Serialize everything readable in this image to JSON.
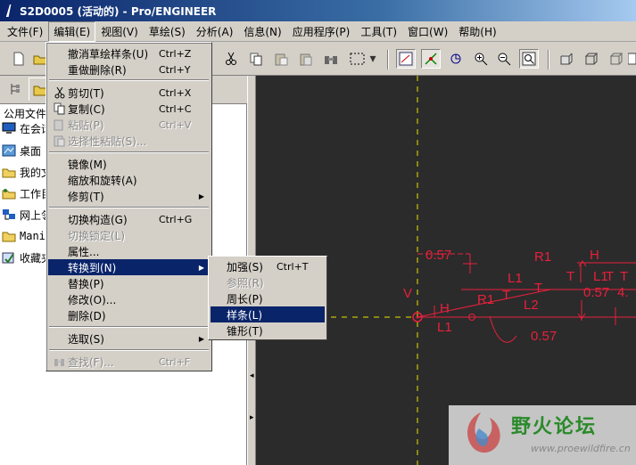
{
  "window": {
    "title": "S2D0005 (活动的) - Pro/ENGINEER"
  },
  "menubar": {
    "items": [
      "文件(F)",
      "编辑(E)",
      "视图(V)",
      "草绘(S)",
      "分析(A)",
      "信息(N)",
      "应用程序(P)",
      "工具(T)",
      "窗口(W)",
      "帮助(H)"
    ],
    "active": "编辑(E)"
  },
  "left_panel": {
    "header": "公用文件",
    "items": [
      "在会话",
      "桌面",
      "我的文",
      "工作目",
      "网上邻",
      "Manik",
      "收藏夹"
    ]
  },
  "edit_menu": {
    "items": [
      {
        "label": "撤消草绘样条(U)",
        "shortcut": "Ctrl+Z",
        "icon": "",
        "enabled": true
      },
      {
        "label": "重做删除(R)",
        "shortcut": "Ctrl+Y",
        "icon": "",
        "enabled": true
      },
      {
        "label": "剪切(T)",
        "shortcut": "Ctrl+X",
        "icon": "scissors-icon",
        "enabled": true
      },
      {
        "label": "复制(C)",
        "shortcut": "Ctrl+C",
        "icon": "copy-icon",
        "enabled": true
      },
      {
        "label": "粘贴(P)",
        "shortcut": "Ctrl+V",
        "icon": "paste-icon",
        "enabled": false
      },
      {
        "label": "选择性粘贴(S)...",
        "shortcut": "",
        "icon": "paste-special-icon",
        "enabled": false
      },
      {
        "label": "镜像(M)",
        "shortcut": "",
        "icon": "",
        "enabled": true
      },
      {
        "label": "缩放和旋转(A)",
        "shortcut": "",
        "icon": "",
        "enabled": true
      },
      {
        "label": "修剪(T)",
        "shortcut": "",
        "icon": "",
        "enabled": true,
        "submenu": true
      },
      {
        "label": "切换构造(G)",
        "shortcut": "Ctrl+G",
        "icon": "",
        "enabled": true
      },
      {
        "label": "切换锁定(L)",
        "shortcut": "",
        "icon": "",
        "enabled": false
      },
      {
        "label": "属性...",
        "shortcut": "",
        "icon": "",
        "enabled": true
      },
      {
        "label": "转换到(N)",
        "shortcut": "",
        "icon": "",
        "enabled": true,
        "submenu": true,
        "highlighted": true
      },
      {
        "label": "替换(P)",
        "shortcut": "",
        "icon": "",
        "enabled": true
      },
      {
        "label": "修改(O)...",
        "shortcut": "",
        "icon": "",
        "enabled": true
      },
      {
        "label": "删除(D)",
        "shortcut": "",
        "icon": "",
        "enabled": true
      },
      {
        "label": "选取(S)",
        "shortcut": "",
        "icon": "",
        "enabled": true,
        "submenu": true
      },
      {
        "label": "查找(F)...",
        "shortcut": "Ctrl+F",
        "icon": "find-icon",
        "enabled": false
      }
    ]
  },
  "convert_submenu": {
    "items": [
      {
        "label": "加强(S)",
        "shortcut": "Ctrl+T",
        "enabled": true
      },
      {
        "label": "参照(R)",
        "shortcut": "",
        "enabled": false
      },
      {
        "label": "周长(P)",
        "shortcut": "",
        "enabled": true
      },
      {
        "label": "样条(L)",
        "shortcut": "",
        "enabled": true,
        "highlighted": true
      },
      {
        "label": "锥形(T)",
        "shortcut": "",
        "enabled": true
      }
    ]
  },
  "sketch": {
    "dim1": "0.57",
    "dim2": "0.57",
    "dim3": "0.57",
    "dim4": "4.",
    "labels": [
      "V",
      "H",
      "L1",
      "R1",
      "T",
      "L2",
      "R1",
      "H",
      "T",
      "L1",
      "T",
      "T",
      "L1",
      "T"
    ]
  },
  "watermark": {
    "text": "野火论坛",
    "url": "www.proewildfire.cn"
  },
  "colors": {
    "canvas_bg": "#2b2b2b",
    "sketch": "#e8203c",
    "centerline": "#e6e600",
    "menu_highlight": "#0a246a"
  }
}
